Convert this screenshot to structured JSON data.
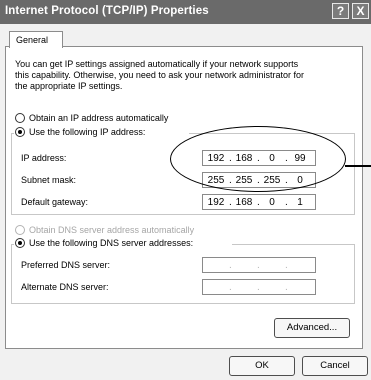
{
  "window": {
    "title": "Internet Protocol (TCP/IP) Properties",
    "help_button": "?",
    "close_button": "X"
  },
  "tabs": [
    {
      "label": "General",
      "selected": true
    }
  ],
  "intro_text": [
    "You can get IP settings assigned automatically if your network supports",
    "this capability. Otherwise, you need to ask your network administrator for",
    "the appropriate IP settings."
  ],
  "ip_mode": {
    "auto_label": "Obtain an IP address automatically",
    "manual_label": "Use the following IP address:",
    "selected": "manual"
  },
  "ip_address": {
    "label": "IP address:",
    "octets": [
      "192",
      "168",
      "0",
      "99"
    ]
  },
  "subnet_mask": {
    "label": "Subnet mask:",
    "octets": [
      "255",
      "255",
      "255",
      "0"
    ]
  },
  "default_gateway": {
    "label": "Default gateway:",
    "octets": [
      "192",
      "168",
      "0",
      "1"
    ]
  },
  "dns_mode": {
    "auto_label": "Obtain DNS server address automatically",
    "manual_label": "Use the following DNS server addresses:",
    "selected": "manual",
    "auto_enabled": false
  },
  "preferred_dns": {
    "label": "Preferred DNS server:",
    "octets": [
      "",
      "",
      "",
      ""
    ]
  },
  "alternate_dns": {
    "label": "Alternate DNS server:",
    "octets": [
      "",
      "",
      "",
      ""
    ]
  },
  "buttons": {
    "advanced": "Advanced...",
    "ok": "OK",
    "cancel": "Cancel"
  },
  "colors": {
    "titlebar": "#6a6a6a",
    "annotation": "#000000"
  }
}
